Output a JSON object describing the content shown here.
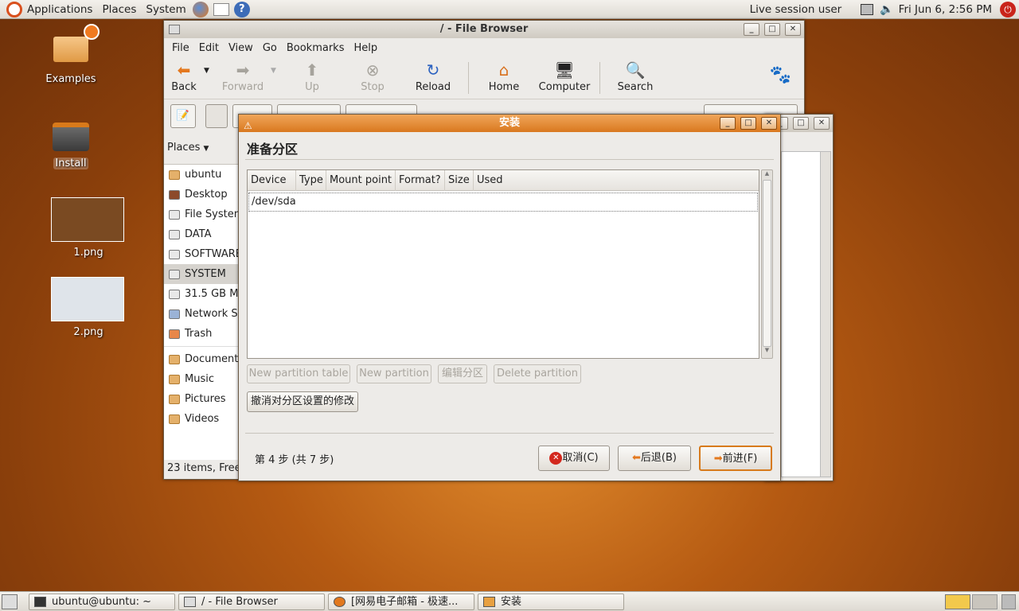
{
  "top_panel": {
    "menus": [
      "Applications",
      "Places",
      "System"
    ],
    "user": "Live session user",
    "clock": "Fri Jun  6,  2:56 PM"
  },
  "desktop": {
    "icons": [
      {
        "label": "Examples",
        "icon": "folder-icon"
      },
      {
        "label": "Install",
        "icon": "install-drive-icon"
      },
      {
        "label": "1.png",
        "icon": "image-thumbnail"
      },
      {
        "label": "2.png",
        "icon": "image-thumbnail"
      }
    ]
  },
  "file_browser": {
    "title": "/ - File Browser",
    "menu": [
      "File",
      "Edit",
      "View",
      "Go",
      "Bookmarks",
      "Help"
    ],
    "toolbar": {
      "back": "Back",
      "forward": "Forward",
      "up": "Up",
      "stop": "Stop",
      "reload": "Reload",
      "home": "Home",
      "computer": "Computer",
      "search": "Search"
    },
    "places_label": "Places",
    "sidebar": [
      "ubuntu",
      "Desktop",
      "File System",
      "DATA",
      "SOFTWARE",
      "SYSTEM",
      "31.5 GB Media",
      "Network Servers",
      "Trash",
      "Documents",
      "Music",
      "Pictures",
      "Videos"
    ],
    "status": "23 items, Free"
  },
  "dialog": {
    "title": "安装",
    "heading": "准备分区",
    "columns": [
      "Device",
      "Type",
      "Mount point",
      "Format?",
      "Size",
      "Used"
    ],
    "rows": [
      "/dev/sda"
    ],
    "buttons": {
      "new_table": "New partition table",
      "new_partition": "New partition",
      "edit_partition": "编辑分区",
      "delete_partition": "Delete partition",
      "undo": "撤消对分区设置的修改",
      "cancel": "取消(C)",
      "back": "后退(B)",
      "forward": "前进(F)"
    },
    "step": "第 4 步 (共 7 步)"
  },
  "bottom_panel": {
    "tasks": [
      "ubuntu@ubuntu: ~",
      "/ - File Browser",
      "[网易电子邮箱 - 极速...",
      "安装"
    ]
  }
}
